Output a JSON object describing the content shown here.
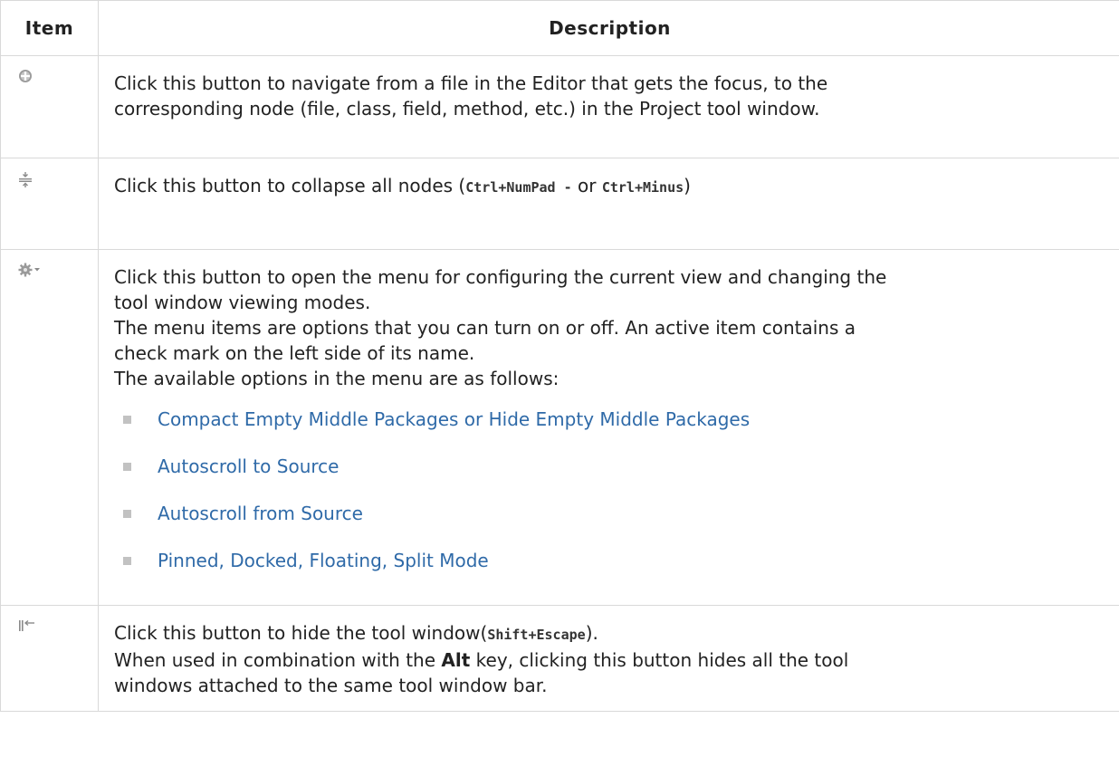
{
  "table": {
    "headers": {
      "item": "Item",
      "description": "Description"
    },
    "rows": [
      {
        "icon": "autoscroll-from-source-icon",
        "line1": "Click this button to navigate from a file in the Editor that gets the focus, to the",
        "line2": "corresponding node (file, class, field, method, etc.) in the Project tool window."
      },
      {
        "icon": "collapse-all-icon",
        "text_before": "Click this button to collapse all nodes (",
        "shortcut1": "Ctrl+NumPad -",
        "text_or": " or ",
        "shortcut2": "Ctrl+Minus",
        "text_after": ")"
      },
      {
        "icon": "gear-dropdown-icon",
        "line1": "Click this button to open the menu for configuring the current view and changing the",
        "line2": "tool window viewing modes.",
        "line3": "The menu items are options that you can turn on or off. An active item contains a",
        "line4": "check mark on the left side of its name.",
        "line5": "The available options in the menu are as follows:",
        "options": [
          "Compact Empty Middle Packages or Hide Empty Middle Packages",
          "Autoscroll to Source",
          "Autoscroll from Source",
          "Pinned, Docked, Floating, Split Mode"
        ]
      },
      {
        "icon": "hide-tool-window-icon",
        "text_before": "Click this button to hide the tool window(",
        "shortcut": "Shift+Escape",
        "text_after": ").",
        "line2_before": "When used in combination with the ",
        "key": "Alt",
        "line2_after": " key, clicking this button hides all the tool",
        "line3": "windows attached to the same tool window bar."
      }
    ]
  },
  "colors": {
    "link": "#2f6aa8",
    "border": "#d9d9d9",
    "bullet": "#c2c2c2",
    "icon": "#8a8a8a"
  }
}
